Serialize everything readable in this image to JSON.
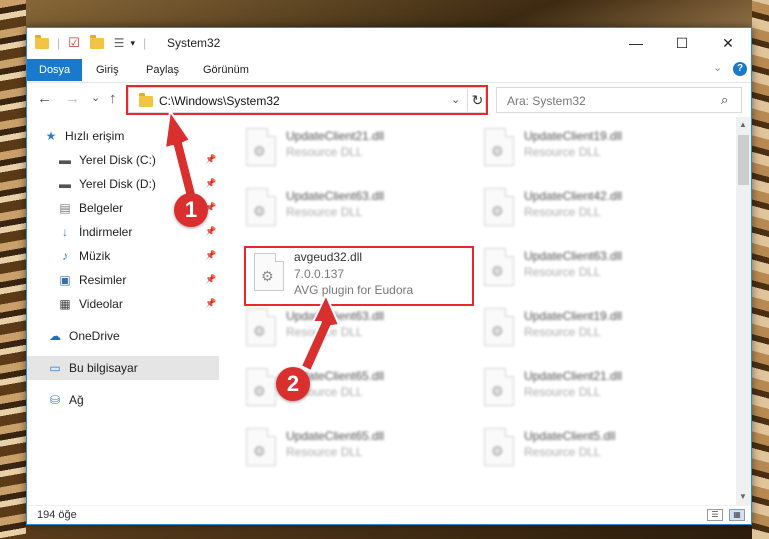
{
  "window": {
    "title": "System32",
    "controls": {
      "minimize": "—",
      "maximize": "☐",
      "close": "✕"
    }
  },
  "ribbon": {
    "tabs": [
      "Dosya",
      "Giriş",
      "Paylaş",
      "Görünüm"
    ],
    "active_tab": "Dosya",
    "help": "?"
  },
  "nav": {
    "address": "C:\\Windows\\System32",
    "search_placeholder": "Ara: System32",
    "back_icon": "←",
    "forward_icon": "→",
    "recent_icon": "⌄",
    "up_icon": "↑",
    "refresh_icon": "↻",
    "dropdown_icon": "⌄",
    "search_icon": "⌕"
  },
  "sidebar": {
    "quick_access": "Hızlı erişim",
    "items": [
      {
        "label": "Yerel Disk (C:)",
        "icon": "drive-icon",
        "pinned": true
      },
      {
        "label": "Yerel Disk (D:)",
        "icon": "drive-icon",
        "pinned": true
      },
      {
        "label": "Belgeler",
        "icon": "documents-icon",
        "pinned": true
      },
      {
        "label": "İndirmeler",
        "icon": "downloads-icon",
        "pinned": true
      },
      {
        "label": "Müzik",
        "icon": "music-icon",
        "pinned": true
      },
      {
        "label": "Resimler",
        "icon": "pictures-icon",
        "pinned": true
      },
      {
        "label": "Videolar",
        "icon": "videos-icon",
        "pinned": true
      }
    ],
    "onedrive": "OneDrive",
    "this_pc": "Bu bilgisayar",
    "network": "Ağ"
  },
  "files": {
    "left": [
      {
        "name": "UpdateClient21.dll",
        "type": "Resource DLL"
      },
      {
        "name": "UpdateClient63.dll",
        "type": "Resource DLL"
      },
      {
        "name": "avgeud32.dll",
        "version": "7.0.0.137",
        "description": "AVG plugin for Eudora"
      },
      {
        "name": "UpdateClient63.dll",
        "type": "Resource DLL"
      },
      {
        "name": "UpdateClient65.dll",
        "type": "Resource DLL"
      },
      {
        "name": "UpdateClient65.dll",
        "type": "Resource DLL"
      }
    ],
    "right": [
      {
        "name": "UpdateClient19.dll",
        "type": "Resource DLL"
      },
      {
        "name": "UpdateClient42.dll",
        "type": "Resource DLL"
      },
      {
        "name": "UpdateClient63.dll",
        "type": "Resource DLL"
      },
      {
        "name": "UpdateClient19.dll",
        "type": "Resource DLL"
      },
      {
        "name": "UpdateClient21.dll",
        "type": "Resource DLL"
      },
      {
        "name": "UpdateClient5.dll",
        "type": "Resource DLL"
      }
    ]
  },
  "status": {
    "item_count": "194 öğe"
  },
  "annotations": {
    "step1": "1",
    "step2": "2",
    "highlight_color": "#e8282b",
    "badge_color": "#d9302f"
  }
}
